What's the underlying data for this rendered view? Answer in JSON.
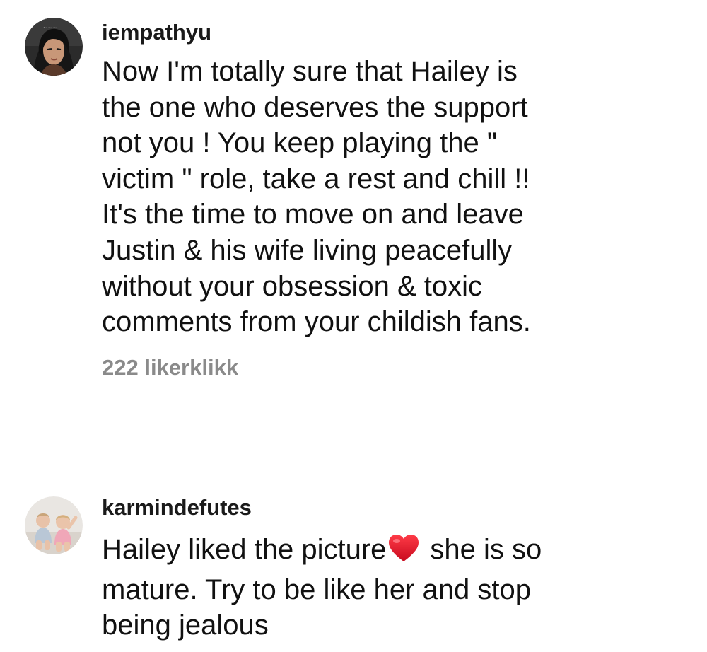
{
  "comments": [
    {
      "username": "iempathyu",
      "text_lines": [
        "Now I'm totally sure that Hailey is",
        "the one who deserves the support",
        "not you ! You keep playing the \"",
        "victim \" role, take a rest and chill !!",
        "It's the time to move on and leave",
        "Justin & his wife living peacefully",
        "without your obsession & toxic",
        "comments from your childish fans."
      ],
      "likes": "222 likerklikk"
    },
    {
      "username": "karmindefutes",
      "text_line1_before": "Hailey liked the picture",
      "text_line1_after": "she is so",
      "text_line1_emoji": "red-heart",
      "text_lines_rest": [
        "mature. Try to be like her and stop",
        "being jealous"
      ]
    }
  ],
  "colors": {
    "text": "#111111",
    "muted": "#8a8a8a",
    "heart": "#e0112b"
  }
}
